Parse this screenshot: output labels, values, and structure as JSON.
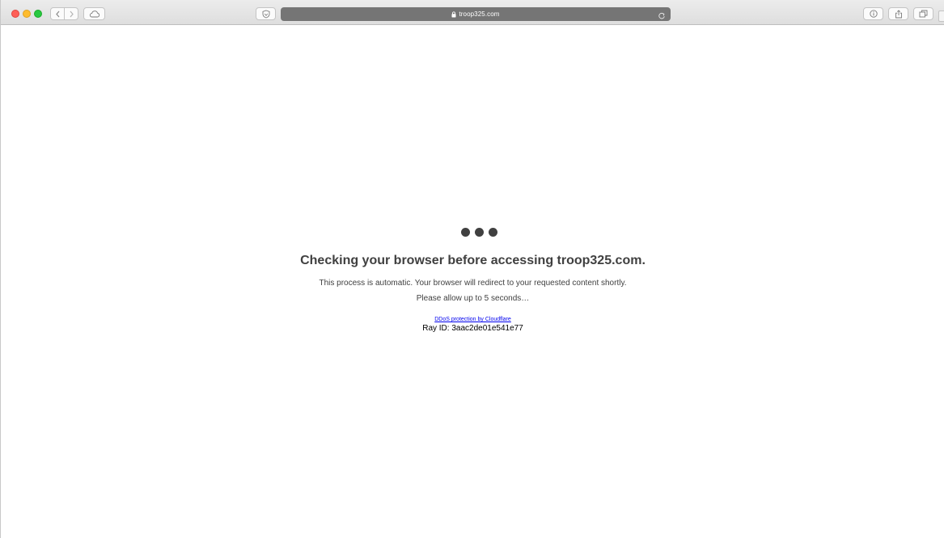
{
  "browser": {
    "address_bar": {
      "url": "troop325.com"
    },
    "icons": {
      "back": "chevron-left-icon",
      "forward": "chevron-right-icon",
      "icloud_tabs": "cloud-icon",
      "shield": "shield-icon",
      "lock": "lock-icon",
      "reload": "reload-icon",
      "info": "info-icon",
      "share": "share-icon",
      "tabs": "tabs-icon"
    },
    "colors": {
      "close": "#fe5f57",
      "minimize": "#febc2e",
      "zoom": "#28c840"
    }
  },
  "page": {
    "headline": "Checking your browser before accessing troop325.com.",
    "message_line_1": "This process is automatic. Your browser will redirect to your requested content shortly.",
    "message_line_2": "Please allow up to 5 seconds…",
    "protection_link": "DDoS protection by Cloudflare",
    "ray_id": "Ray ID: 3aac2de01e541e77",
    "text_color": "#404040",
    "link_color": "#0000ee"
  }
}
